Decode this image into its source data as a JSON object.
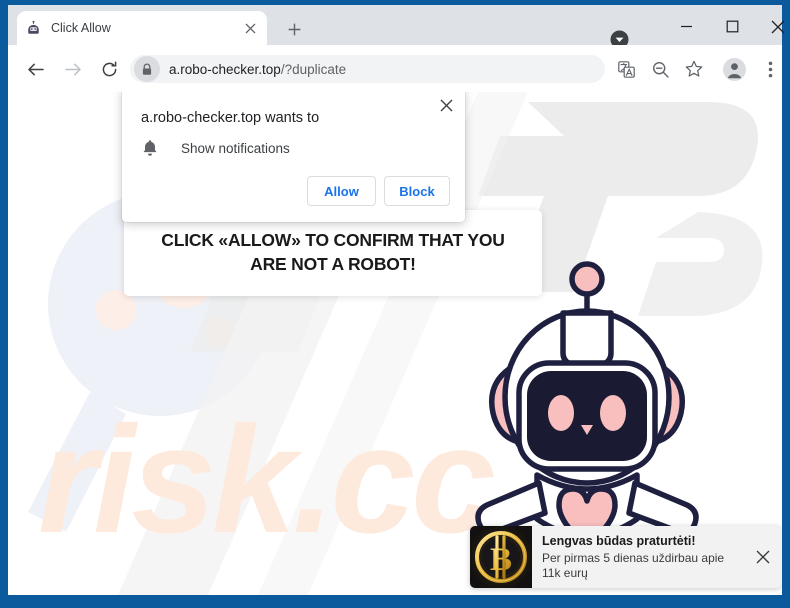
{
  "window": {
    "frame_color": "#0b5a9e",
    "controls": {
      "chevron_icon": "chevron-down-circle-icon",
      "minimize_icon": "minimize-icon",
      "maximize_icon": "maximize-icon",
      "close_icon": "close-icon"
    }
  },
  "tab_bar": {
    "tab": {
      "title": "Click Allow",
      "favicon_icon": "robot-head-favicon",
      "close_icon": "close-icon"
    },
    "new_tab_icon": "plus-icon"
  },
  "toolbar": {
    "back_icon": "arrow-left-icon",
    "forward_icon": "arrow-right-icon",
    "reload_icon": "reload-icon",
    "lock_icon": "lock-icon",
    "url_host": "a.robo-checker.top",
    "url_path": "/?duplicate",
    "icons": [
      {
        "name": "translate-icon"
      },
      {
        "name": "zoom-out-icon"
      },
      {
        "name": "bookmark-star-icon"
      },
      {
        "name": "profile-avatar-icon"
      },
      {
        "name": "more-menu-icon"
      }
    ]
  },
  "permission_dialog": {
    "title": "a.robo-checker.top wants to",
    "permission_label": "Show notifications",
    "permission_icon": "bell-icon",
    "allow_label": "Allow",
    "block_label": "Block",
    "close_icon": "close-icon",
    "button_color": "#1a73e8"
  },
  "page": {
    "speech_bubble_text": "CLICK «ALLOW» TO CONFIRM THAT YOU\nARE NOT A ROBOT!",
    "mascot": "robot-mascot-illustration",
    "watermark_text": "risk.cc",
    "accent_pink": "#f9bfbf",
    "outline_navy": "#1f2040"
  },
  "toast_notification": {
    "icon": "bitcoin-coin-icon",
    "title": "Lengvas būdas praturtėti!",
    "description": "Per pirmas 5 dienas uždirbau apie 11k eurų",
    "close_icon": "close-icon"
  }
}
